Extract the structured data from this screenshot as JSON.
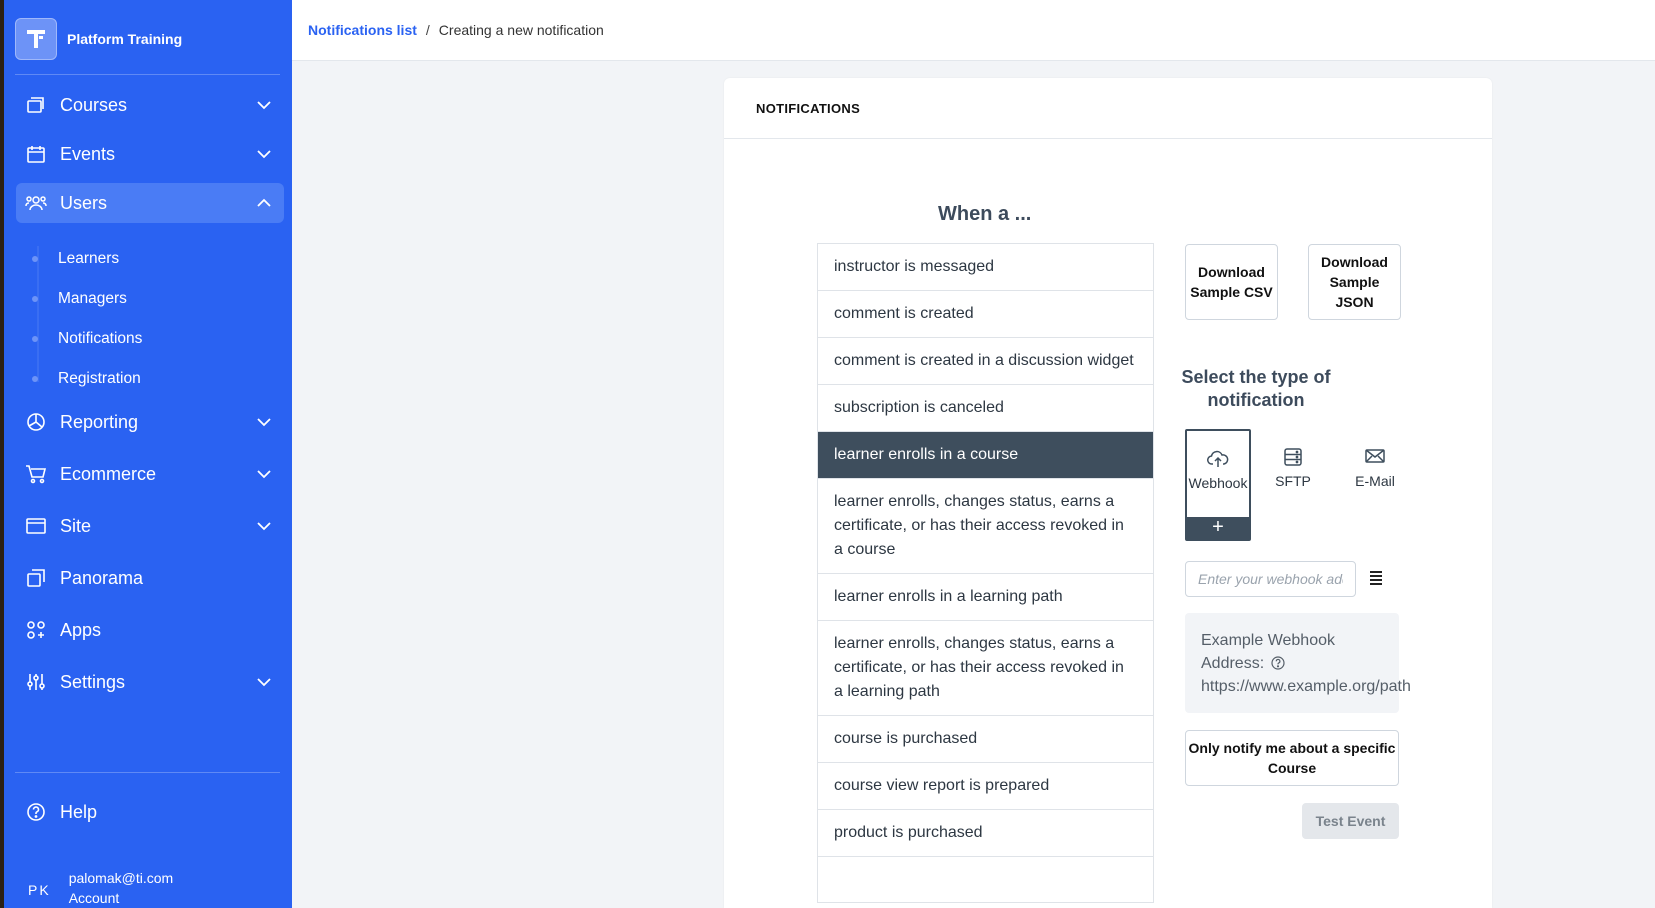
{
  "app": {
    "name": "Platform Training",
    "logo_letter": "T"
  },
  "sidebar": {
    "items": [
      {
        "label": "Courses",
        "icon": "courses-icon",
        "expandable": true
      },
      {
        "label": "Events",
        "icon": "calendar-icon",
        "expandable": true
      },
      {
        "label": "Users",
        "icon": "users-icon",
        "expandable": true,
        "expanded": true
      },
      {
        "label": "Reporting",
        "icon": "pie-chart-icon",
        "expandable": true
      },
      {
        "label": "Ecommerce",
        "icon": "cart-icon",
        "expandable": true
      },
      {
        "label": "Site",
        "icon": "browser-icon",
        "expandable": true
      },
      {
        "label": "Panorama",
        "icon": "panorama-icon",
        "expandable": false
      },
      {
        "label": "Apps",
        "icon": "apps-icon",
        "expandable": false
      },
      {
        "label": "Settings",
        "icon": "sliders-icon",
        "expandable": true
      }
    ],
    "users_sub": [
      "Learners",
      "Managers",
      "Notifications",
      "Registration"
    ],
    "help": "Help",
    "account": {
      "initials": "PK",
      "email": "palomak@ti.com",
      "label": "Account"
    }
  },
  "breadcrumb": {
    "link": "Notifications list",
    "separator": "/",
    "current": "Creating a new notification"
  },
  "card": {
    "header": "NOTIFICATIONS",
    "when_title": "When a ...",
    "triggers": [
      "instructor is messaged",
      "comment is created",
      "comment is created in a discussion widget",
      "subscription is canceled",
      "learner enrolls in a course",
      "learner enrolls, changes status, earns a certificate, or has their access revoked in a course",
      "learner enrolls in a learning path",
      "learner enrolls, changes status, earns a certificate, or has their access revoked in a learning path",
      "course is purchased",
      "course view report is prepared",
      "product is purchased",
      ""
    ],
    "selected_trigger": "learner enrolls in a course",
    "download_csv": "Download Sample CSV",
    "download_json": "Download Sample JSON",
    "type_title": "Select the type of notification",
    "types": [
      "Webhook",
      "SFTP",
      "E-Mail"
    ],
    "selected_type": "Webhook",
    "add_symbol": "+",
    "webhook_placeholder": "Enter your webhook address",
    "example_label": "Example Webhook Address:",
    "example_url": "https://www.example.org/path",
    "notify_button": "Only notify me about a specific Course",
    "test_button": "Test Event"
  }
}
